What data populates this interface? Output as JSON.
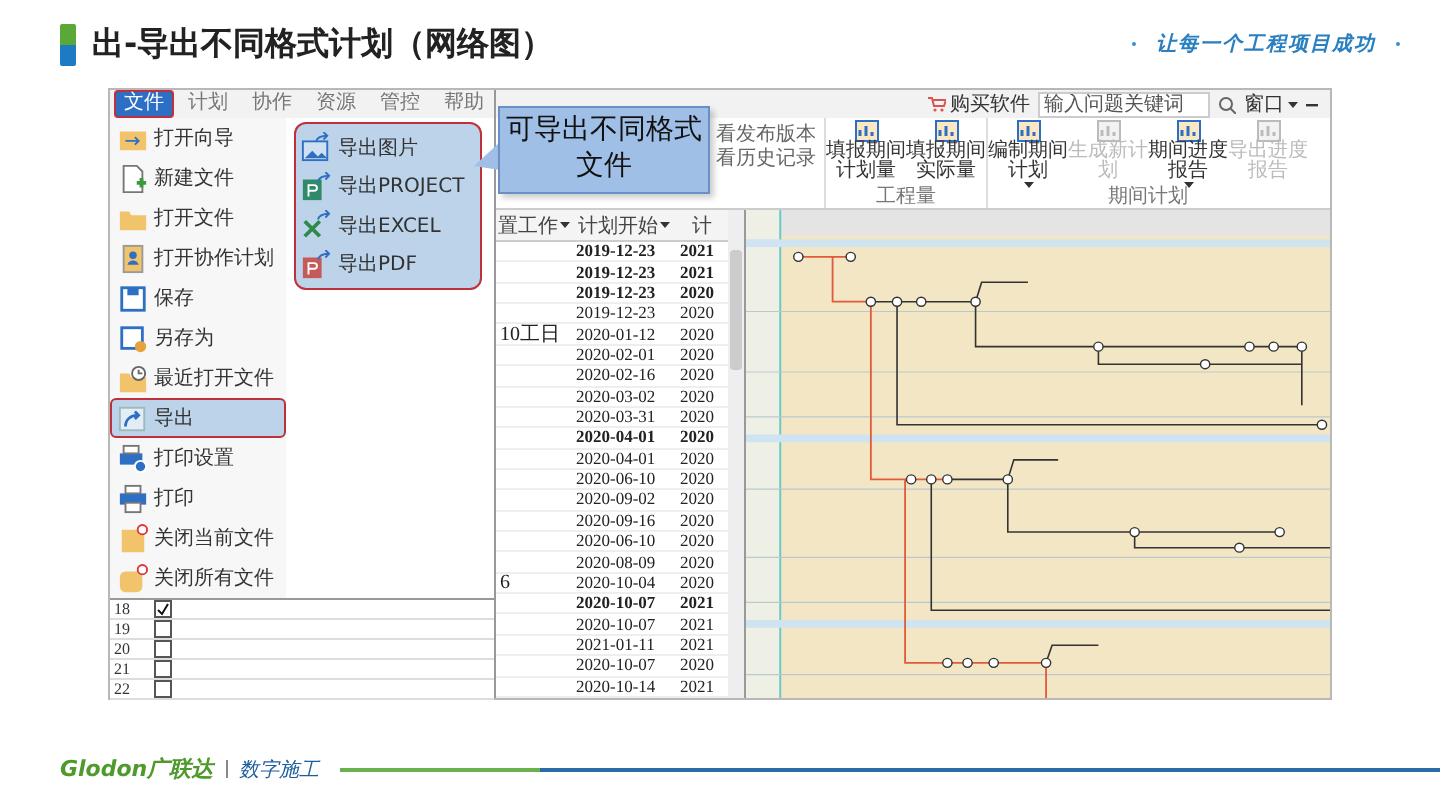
{
  "slide": {
    "title": "出-导出不同格式计划（网络图）",
    "slogan": "让每一个工程项目成功"
  },
  "app": {
    "tabs": [
      {
        "label": "文件",
        "selected": true
      },
      {
        "label": "计划",
        "selected": false
      },
      {
        "label": "协作",
        "selected": false
      },
      {
        "label": "资源",
        "selected": false
      },
      {
        "label": "管控",
        "selected": false
      },
      {
        "label": "帮助",
        "selected": false
      }
    ],
    "file_menu": [
      {
        "label": "打开向导",
        "selected": false
      },
      {
        "label": "新建文件",
        "selected": false
      },
      {
        "label": "打开文件",
        "selected": false
      },
      {
        "label": "打开协作计划",
        "selected": false
      },
      {
        "label": "保存",
        "selected": false
      },
      {
        "label": "另存为",
        "selected": false
      },
      {
        "label": "最近打开文件",
        "selected": false
      },
      {
        "label": "导出",
        "selected": true
      },
      {
        "label": "打印设置",
        "selected": false
      },
      {
        "label": "打印",
        "selected": false
      },
      {
        "label": "关闭当前文件",
        "selected": false
      },
      {
        "label": "关闭所有文件",
        "selected": false
      }
    ],
    "export_submenu": [
      {
        "label": "导出图片"
      },
      {
        "label": "导出PROJECT"
      },
      {
        "label": "导出EXCEL"
      },
      {
        "label": "导出PDF"
      }
    ],
    "task_rows": [
      {
        "number": "18",
        "checked": true
      },
      {
        "number": "19",
        "checked": false
      },
      {
        "number": "20",
        "checked": false
      },
      {
        "number": "21",
        "checked": false
      },
      {
        "number": "22",
        "checked": false
      }
    ],
    "top_bar": {
      "buy_label": "购买软件",
      "search": {
        "placeholder": "输入问题关键词"
      },
      "window_menu": "窗口"
    },
    "ribbon": {
      "history_links": [
        "看发布版本",
        "看历史记录"
      ],
      "groups": [
        {
          "label": "工程量",
          "buttons": [
            {
              "label": "填报期间计划量",
              "disabled": false,
              "dropdown": false
            },
            {
              "label": "填报期间实际量",
              "disabled": false,
              "dropdown": false
            }
          ]
        },
        {
          "label": "期间计划",
          "buttons": [
            {
              "label": "编制期间计划",
              "disabled": false,
              "dropdown": true
            },
            {
              "label": "生成新计划",
              "disabled": true,
              "dropdown": false
            },
            {
              "label": "期间进度报告",
              "disabled": false,
              "dropdown": true
            },
            {
              "label": "导出进度报告",
              "disabled": true,
              "dropdown": false
            }
          ]
        }
      ]
    },
    "table": {
      "columns": [
        "置工作",
        "计划开始",
        "计"
      ],
      "rows": [
        {
          "summary": true,
          "start": "2019-12-23",
          "column_3": "2021"
        },
        {
          "summary": true,
          "start": "2019-12-23",
          "column_3": "2021"
        },
        {
          "summary": true,
          "start": "2019-12-23",
          "column_3": "2020"
        },
        {
          "summary": false,
          "start": "2019-12-23",
          "column_3": "2020"
        },
        {
          "summary": false,
          "column_1": "10工日",
          "start": "2020-01-12",
          "column_3": "2020"
        },
        {
          "summary": false,
          "start": "2020-02-01",
          "column_3": "2020"
        },
        {
          "summary": false,
          "start": "2020-02-16",
          "column_3": "2020"
        },
        {
          "summary": false,
          "start": "2020-03-02",
          "column_3": "2020"
        },
        {
          "summary": false,
          "start": "2020-03-31",
          "column_3": "2020"
        },
        {
          "summary": true,
          "start": "2020-04-01",
          "column_3": "2020"
        },
        {
          "summary": false,
          "start": "2020-04-01",
          "column_3": "2020"
        },
        {
          "summary": false,
          "start": "2020-06-10",
          "column_3": "2020"
        },
        {
          "summary": false,
          "start": "2020-09-02",
          "column_3": "2020"
        },
        {
          "summary": false,
          "start": "2020-09-16",
          "column_3": "2020"
        },
        {
          "summary": false,
          "start": "2020-06-10",
          "column_3": "2020"
        },
        {
          "summary": false,
          "start": "2020-08-09",
          "column_3": "2020"
        },
        {
          "summary": false,
          "column_1": "6",
          "start": "2020-10-04",
          "column_3": "2020"
        },
        {
          "summary": true,
          "start": "2020-10-07",
          "column_3": "2021"
        },
        {
          "summary": false,
          "start": "2020-10-07",
          "column_3": "2021"
        },
        {
          "summary": false,
          "start": "2021-01-11",
          "column_3": "2021"
        },
        {
          "summary": false,
          "start": "2020-10-07",
          "column_3": "2020"
        },
        {
          "summary": false,
          "start": "2020-10-14",
          "column_3": "2021"
        }
      ]
    }
  },
  "callout": {
    "text": "可导出不同格式文件"
  },
  "footer": {
    "logo": "Glodon广联达",
    "tagline": "数字施工"
  }
}
